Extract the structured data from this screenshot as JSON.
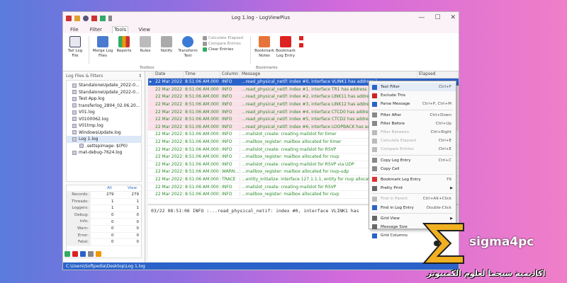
{
  "window": {
    "title": "Log 1.log - LogViewPlus",
    "min": "—",
    "max": "☐",
    "close": "✕"
  },
  "menu": [
    "File",
    "Filter",
    "Tools",
    "View"
  ],
  "ribbon": {
    "tail": "Tail Log File",
    "merge": "Merge Log Files",
    "reports": "Reports",
    "rules": "Rules",
    "notify": "Notify",
    "transform": "Transform Text",
    "calc": "Calculate Elapsed",
    "compare": "Compare Entries",
    "clear": "Clear Entries",
    "bm_notes": "Bookmark Notes",
    "bm_entry": "Bookmark Log Entry",
    "group_toolbox": "Toolbox",
    "group_bookmarks": "Bookmarks"
  },
  "left": {
    "header": "Log Files & Filters",
    "header_icon": "⇕",
    "files": [
      "StandaloneUpdate_2022-0...",
      "StandaloneUpdate_2022-0...",
      "Test App.log",
      "transferlog_2804_02.06.20...",
      "V01.log",
      "V0100062.log",
      "V01tmp.log",
      "WindowsUpdate.log",
      "Log 1.log",
      ".settspimage: $(P0)",
      "mat-debug-7624.log"
    ],
    "stats_headers": [
      "All",
      "View"
    ],
    "stats": [
      {
        "k": "Records:",
        "all": "279",
        "view": "279"
      },
      {
        "k": "Threads:",
        "all": "1",
        "view": "1"
      },
      {
        "k": "Loggers:",
        "all": "1",
        "view": "1"
      },
      {
        "k": "Debug:",
        "all": "0",
        "view": "0"
      },
      {
        "k": "Info:",
        "all": "0",
        "view": "0"
      },
      {
        "k": "Warn:",
        "all": "0",
        "view": "0"
      },
      {
        "k": "Error:",
        "all": "0",
        "view": "0"
      },
      {
        "k": "Fatal:",
        "all": "0",
        "view": "0"
      }
    ]
  },
  "grid": {
    "headers": [
      "Date",
      "Time",
      "Column",
      "Message",
      "Elapsed"
    ],
    "rows": [
      {
        "date": "22 Mar 2022",
        "time": "8:51:06 AM.000",
        "lvl": "INFO",
        "msg": "...read_physical_netif: index #0, interface VLINK1 has address 1...",
        "el": ""
      },
      {
        "date": "22 Mar 2022",
        "time": "8:51:06 AM.000",
        "lvl": "INFO",
        "msg": "...read_physical_netif: index #1, interface TR1 has address 9.37.6...",
        "el": ""
      },
      {
        "date": "22 Mar 2022",
        "time": "8:51:06 AM.000",
        "lvl": "INFO",
        "msg": "...read_physical_netif: index #2, interface LINK11 has address 9...",
        "el": ""
      },
      {
        "date": "22 Mar 2022",
        "time": "8:51:06 AM.000",
        "lvl": "INFO",
        "msg": "...read_physical_netif: index #3, interface LINK12 has address 9...",
        "el": ""
      },
      {
        "date": "22 Mar 2022",
        "time": "8:51:06 AM.000",
        "lvl": "INFO",
        "msg": "...read_physical_netif: index #4, interface CTCD0 has address 9.6...",
        "el": ""
      },
      {
        "date": "22 Mar 2022",
        "time": "8:51:06 AM.000",
        "lvl": "INFO",
        "msg": "...read_physical_netif: index #5, interface CTCD2 has address 9.6...",
        "el": ""
      },
      {
        "date": "22 Mar 2022",
        "time": "8:51:06 AM.000",
        "lvl": "INFO",
        "msg": "...read_physical_netif: index #6, interface LOOPBACK has address ...",
        "el": ""
      },
      {
        "date": "22 Mar 2022",
        "time": "8:51:06 AM.000",
        "lvl": "INFO",
        "msg": "...mailslot_create: creating mailslot for timer",
        "el": ""
      },
      {
        "date": "22 Mar 2022",
        "time": "8:51:06 AM.000",
        "lvl": "INFO",
        "msg": "...mailbox_register: mailbox allocated for timer",
        "el": ""
      },
      {
        "date": "22 Mar 2022",
        "time": "8:51:06 AM.000",
        "lvl": "INFO",
        "msg": "...mailslot_create: creating mailslot for RSVP",
        "el": ""
      },
      {
        "date": "22 Mar 2022",
        "time": "8:51:06 AM.000",
        "lvl": "INFO",
        "msg": "...mailbox_register: mailbox allocated for rsvp",
        "el": ""
      },
      {
        "date": "22 Mar 2022",
        "time": "8:51:06 AM.000",
        "lvl": "INFO",
        "msg": "...mailslot_create: creating mailslot for RSVP via UDP",
        "el": ""
      },
      {
        "date": "22 Mar 2022",
        "time": "8:51:06 AM.000",
        "lvl": "WARN...",
        "msg": "...mailbox_register: mailbox allocated for rsvp-udp",
        "el": ""
      },
      {
        "date": "22 Mar 2022",
        "time": "8:51:06 AM.000",
        "lvl": "TRACE",
        "msg": "...entity_initialize: interface 127.1.1.1, entity for rsvp allocated and...",
        "el": ""
      },
      {
        "date": "22 Mar 2022",
        "time": "8:51:06 AM.000",
        "lvl": "INFO",
        "msg": "...mailslot_create: creating mailslot for RSVP",
        "el": ""
      },
      {
        "date": "22 Mar 2022",
        "time": "8:51:06 AM.000",
        "lvl": "INFO",
        "msg": "...mailbox_register: mailbox allocated for rsvp",
        "el": ""
      }
    ]
  },
  "detail": "03/22 08:51:06 INFO    :...read_physical_netif: index #0, interface VLINK1 has",
  "status": "C:\\Users\\Softpedia\\Desktop\\Log 1.log",
  "menu_ctx": [
    {
      "label": "Text Filter",
      "sc": "Ctrl+F",
      "dis": false,
      "color": "#2a62c9"
    },
    {
      "label": "Exclude This",
      "sc": "",
      "dis": false,
      "color": "#c22"
    },
    {
      "label": "Parse Message",
      "sc": "Ctrl+P, Ctrl+M",
      "dis": false,
      "color": "#2a62c9"
    },
    {
      "sep": true
    },
    {
      "label": "Filter After",
      "sc": "Ctrl+Down",
      "dis": false,
      "color": "#888"
    },
    {
      "label": "Filter Before",
      "sc": "Ctrl+Up",
      "dis": false,
      "color": "#888"
    },
    {
      "label": "Filter Between",
      "sc": "Ctrl+Right",
      "dis": true,
      "color": "#bbb"
    },
    {
      "label": "Calculate Elapsed",
      "sc": "Ctrl+E",
      "dis": true,
      "color": "#bbb"
    },
    {
      "label": "Compare Entries",
      "sc": "Ctrl+E",
      "dis": true,
      "color": "#bbb"
    },
    {
      "sep": true
    },
    {
      "label": "Copy Log Entry",
      "sc": "Ctrl+C",
      "dis": false,
      "color": "#888"
    },
    {
      "label": "Copy Cell",
      "sc": "",
      "dis": false,
      "color": "#888"
    },
    {
      "sep": true
    },
    {
      "label": "Bookmark Log Entry",
      "sc": "F9",
      "dis": false,
      "color": "#d33"
    },
    {
      "label": "Pretty Print",
      "sc": "",
      "dis": false,
      "color": "#666",
      "arrow": true
    },
    {
      "sep": true
    },
    {
      "label": "Find in Parent",
      "sc": "Ctrl+Alt+Click",
      "dis": true,
      "color": "#bbb"
    },
    {
      "label": "Find in Log Entry",
      "sc": "Double-Click",
      "dis": false,
      "color": "#2a62c9"
    },
    {
      "sep": true
    },
    {
      "label": "Grid View",
      "sc": "",
      "dis": false,
      "color": "#666",
      "arrow": true
    },
    {
      "label": "Message Size",
      "sc": "",
      "dis": false,
      "color": "#666",
      "arrow": true
    },
    {
      "label": "Grid Columns",
      "sc": "",
      "dis": false,
      "color": "#2a62c9"
    }
  ],
  "brand": {
    "name": "sigma4pc",
    "arabic": "اكاديمية سيجما لعلوم الكمبيوتر"
  }
}
